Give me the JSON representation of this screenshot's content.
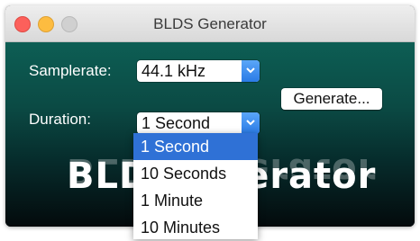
{
  "window": {
    "title": "BLDS Generator"
  },
  "form": {
    "samplerate_label": "Samplerate:",
    "samplerate_value": "44.1 kHz",
    "duration_label": "Duration:",
    "duration_value": "1 Second",
    "generate_label": "Generate..."
  },
  "logo": {
    "left_text": "BLD",
    "right_text": "erator"
  },
  "duration_menu": {
    "items": [
      "1 Second",
      "10 Seconds",
      "1 Minute",
      "10 Minutes"
    ],
    "selected": "1 Second"
  },
  "colors": {
    "accent": "#2f71d6",
    "close": "#fc605b",
    "minimize": "#fdbc40"
  }
}
